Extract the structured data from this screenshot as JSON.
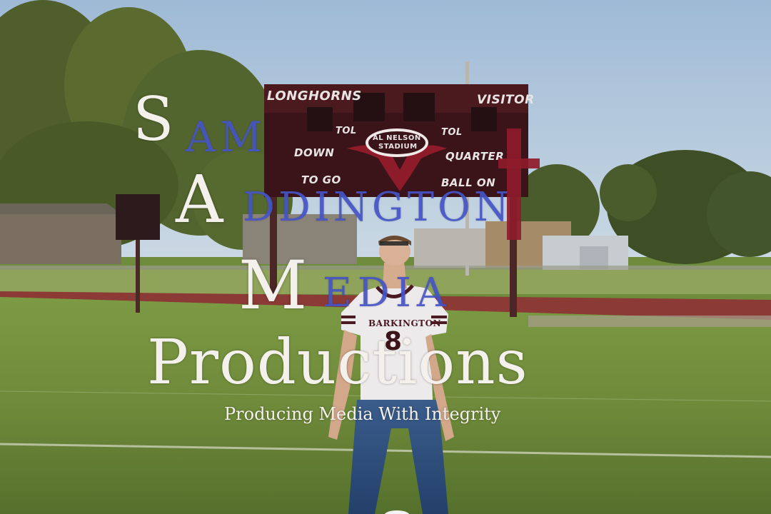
{
  "scoreboard": {
    "home_label": "LONGHORNS",
    "visitor_label": "VISITOR",
    "tol_left": "TOL",
    "tol_right": "TOL",
    "down_label": "DOWN",
    "quarter_label": "QUARTER",
    "to_go_label": "TO GO",
    "ball_on_label": "BALL ON",
    "stadium_line1": "AL NELSON",
    "stadium_line2": "STADIUM"
  },
  "jersey": {
    "name": "BARKINGTON",
    "number": "8"
  },
  "watermark": {
    "sam_initial": "S",
    "sam_rest": "AM",
    "addington_initial": "A",
    "addington_rest": "DDINGTON",
    "media_initial": "M",
    "media_rest": "EDIA",
    "productions": "Productions",
    "tagline": "Producing Media With Integrity"
  },
  "colors": {
    "watermark_white": "#f4f1ec",
    "watermark_blue": "#4655c8",
    "cross_red": "#8e1b2a",
    "scoreboard_maroon": "#3a1418"
  }
}
